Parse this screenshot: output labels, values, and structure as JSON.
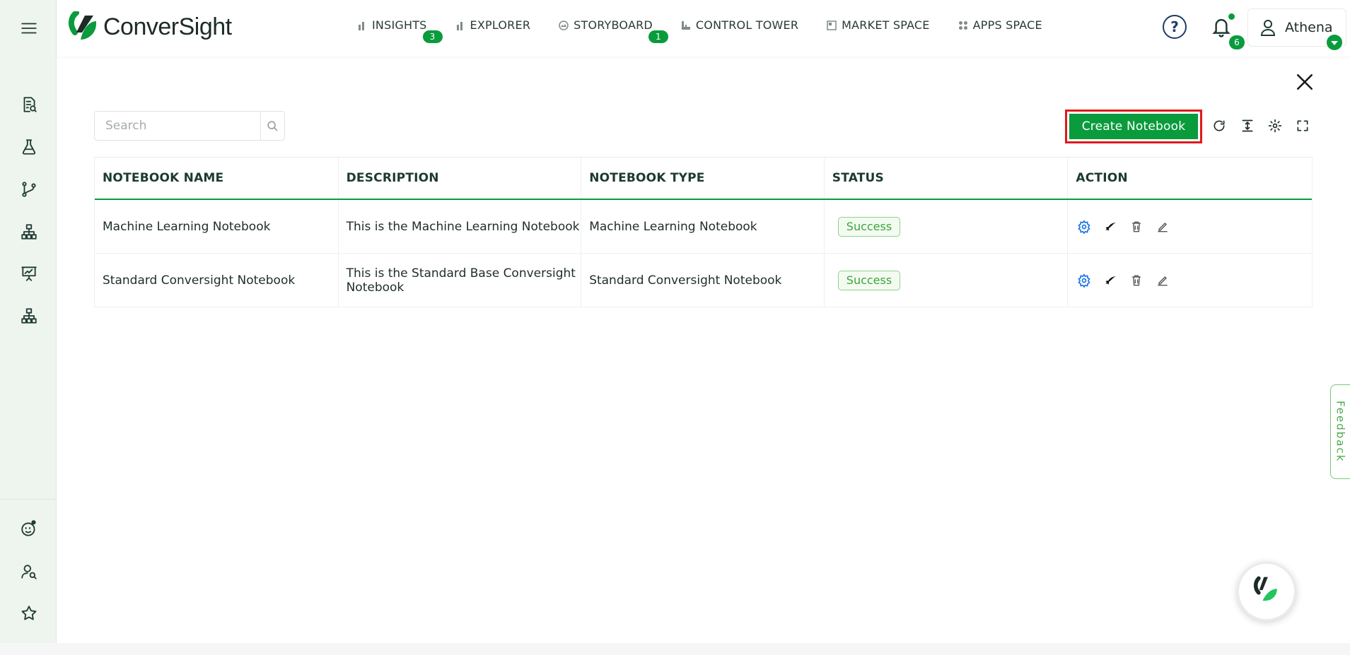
{
  "app": {
    "brand": "ConverSight",
    "colors": {
      "accent": "#0a9b3c",
      "highlight": "#e0191f",
      "sidebar_bg": "#eef4ee"
    }
  },
  "sidebar": {
    "items": [
      {
        "icon": "menu-icon"
      },
      {
        "icon": "report-search-icon"
      },
      {
        "icon": "flask-icon"
      },
      {
        "icon": "branch-icon"
      },
      {
        "icon": "hierarchy-icon"
      },
      {
        "icon": "presentation-icon"
      },
      {
        "icon": "hierarchy-icon-2"
      },
      {
        "icon": "assistant-face-icon"
      },
      {
        "icon": "user-search-icon"
      },
      {
        "icon": "star-icon"
      }
    ]
  },
  "nav": {
    "items": [
      {
        "label": "INSIGHTS",
        "badge": "3",
        "icon": "bar-chart-icon"
      },
      {
        "label": "EXPLORER",
        "badge": "",
        "icon": "bar-chart-icon"
      },
      {
        "label": "STORYBOARD",
        "badge": "1",
        "icon": "storyboard-icon"
      },
      {
        "label": "CONTROL TOWER",
        "badge": "",
        "icon": "control-tower-icon"
      },
      {
        "label": "MARKET SPACE",
        "badge": "",
        "icon": "market-icon"
      },
      {
        "label": "APPS SPACE",
        "badge": "",
        "icon": "grid-icon"
      }
    ]
  },
  "header": {
    "help_label": "?",
    "notifications_count": "6",
    "user_name": "Athena"
  },
  "toolbar": {
    "search_placeholder": "Search",
    "create_label": "Create Notebook"
  },
  "table": {
    "columns": [
      "NOTEBOOK NAME",
      "DESCRIPTION",
      "NOTEBOOK TYPE",
      "STATUS",
      "ACTION"
    ],
    "rows": [
      {
        "name": "Machine Learning Notebook",
        "description": "This is the Machine Learning Notebook",
        "type": "Machine Learning Notebook",
        "status": "Success"
      },
      {
        "name": "Standard Conversight Notebook",
        "description": "This is the Standard Base Conversight Notebook",
        "type": "Standard Conversight Notebook",
        "status": "Success"
      }
    ]
  },
  "feedback_label": "Feedback"
}
